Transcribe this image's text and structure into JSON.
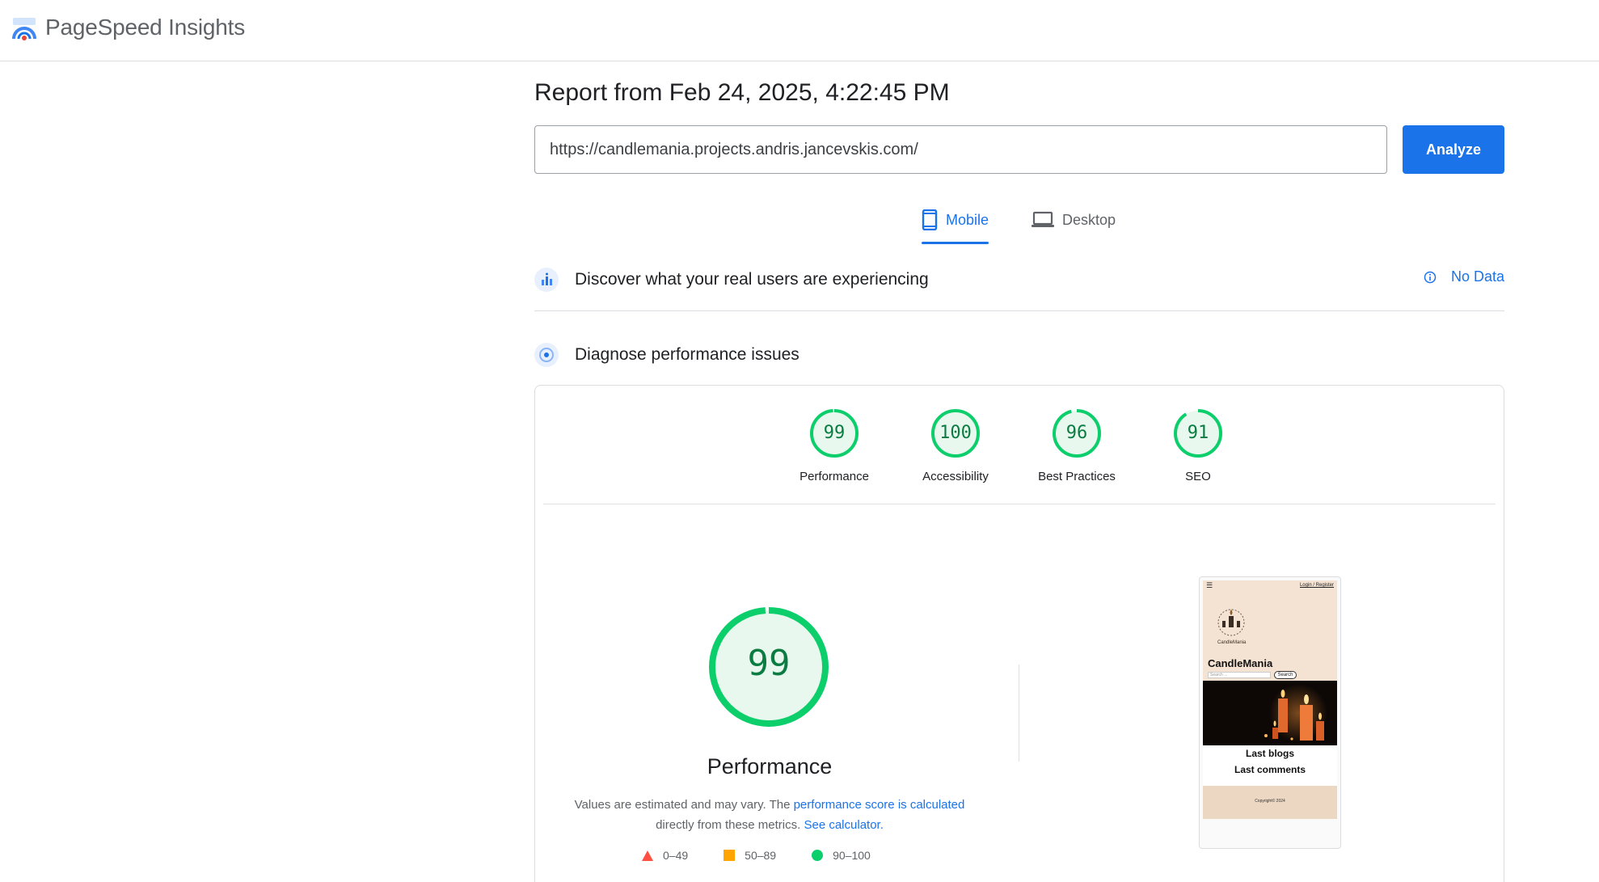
{
  "header": {
    "brand": "PageSpeed Insights"
  },
  "report": {
    "title": "Report from Feb 24, 2025, 4:22:45 PM",
    "url_value": "https://candlemania.projects.andris.jancevskis.com/",
    "analyze_label": "Analyze"
  },
  "tabs": {
    "mobile": "Mobile",
    "desktop": "Desktop",
    "active": "Mobile"
  },
  "real_users": {
    "title": "Discover what your real users are experiencing",
    "status": "No Data"
  },
  "diagnose": {
    "title": "Diagnose performance issues"
  },
  "scores": [
    {
      "label": "Performance",
      "value": 99
    },
    {
      "label": "Accessibility",
      "value": 100
    },
    {
      "label": "Best Practices",
      "value": 96
    },
    {
      "label": "SEO",
      "value": 91
    }
  ],
  "performance": {
    "score": 99,
    "title": "Performance",
    "note_prefix": "Values are estimated and may vary. The ",
    "note_link1": "performance score is calculated",
    "note_middle": " directly from these metrics. ",
    "note_link2": "See calculator."
  },
  "legend": [
    {
      "range": "0–49",
      "shape": "triangle",
      "color": "#ff4e42"
    },
    {
      "range": "50–89",
      "shape": "square",
      "color": "#ffa400"
    },
    {
      "range": "90–100",
      "shape": "circle",
      "color": "#0cce6b"
    }
  ],
  "screenshot": {
    "top_links": "Login / Register",
    "brand": "CandleMania",
    "logo_text": "CandleMania",
    "search_placeholder": "Search ...",
    "search_button": "Search",
    "last_blogs": "Last blogs",
    "last_comments": "Last comments",
    "footer": "Copyright© 2024"
  },
  "colors": {
    "accent": "#1a73e8",
    "pass": "#0cce6b",
    "pass_text": "#0a7c42",
    "pass_fill": "#e8f8ef"
  }
}
